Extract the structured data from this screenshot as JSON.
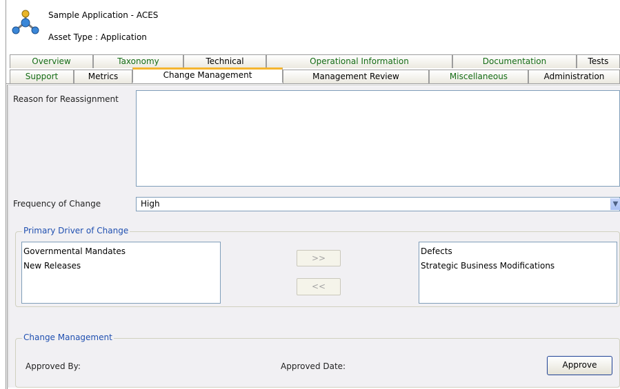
{
  "header": {
    "app_title": "Sample Application - ACES",
    "asset_type": "Asset Type : Application"
  },
  "tabs": {
    "row1": [
      "Overview",
      "Taxonomy",
      "Technical",
      "Operational Information",
      "Documentation",
      "Tests"
    ],
    "row2": [
      "Support",
      "Metrics",
      "Change Management",
      "Management Review",
      "Miscellaneous",
      "Administration"
    ],
    "active": "Change Management"
  },
  "form": {
    "reason_label": "Reason for Reassignment",
    "reason_value": "",
    "frequency_label": "Frequency of Change",
    "frequency_value": "High"
  },
  "primary_driver": {
    "title": "Primary Driver of Change",
    "available": [
      "Governmental Mandates",
      "New Releases"
    ],
    "selected": [
      "Defects",
      "Strategic Business Modifications"
    ],
    "add_label": ">>",
    "remove_label": "<<"
  },
  "change_management": {
    "title": "Change Management",
    "approved_by_label": "Approved By:",
    "approved_date_label": "Approved Date:",
    "approve_label": "Approve"
  },
  "colors": {
    "tab_text": "#146c14",
    "active_tab_accent": "#f5b52e",
    "group_title": "#1f4fb0"
  }
}
